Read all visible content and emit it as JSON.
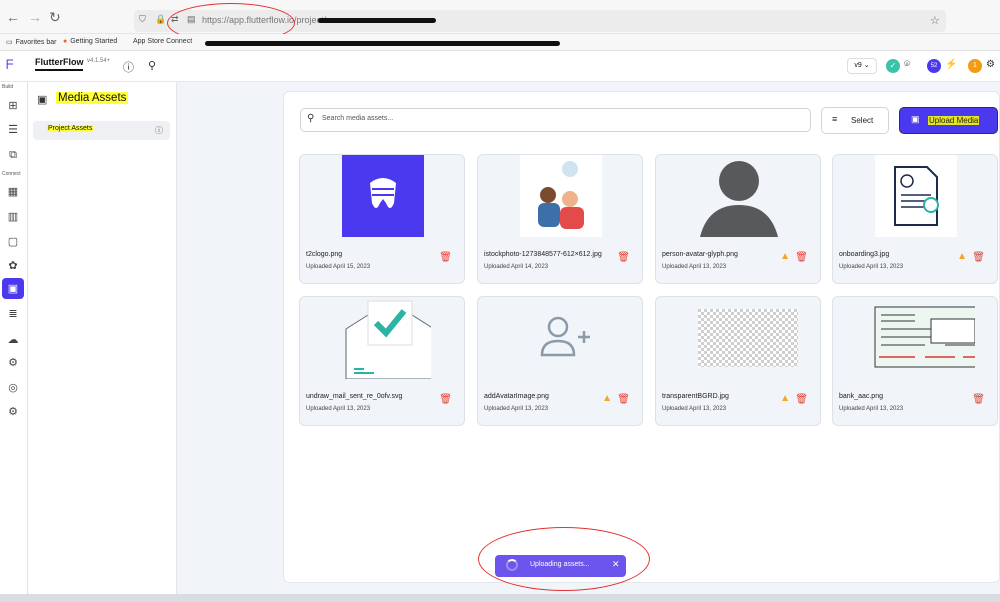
{
  "browser": {
    "url": "https://app.flutterflow.io/project/",
    "favorites": [
      "Favorites bar",
      "Getting Started",
      "App Store Connect"
    ]
  },
  "header": {
    "brand": "FlutterFlow",
    "version": "v4.1.54+",
    "version_picker": "v9",
    "badge_count": "52",
    "notification_count": "1"
  },
  "rail": {
    "build_label": "Build",
    "connect_label": "Connect"
  },
  "panel": {
    "title": "Media Assets",
    "item": "Project Assets"
  },
  "toolbar": {
    "search_placeholder": "Search media assets...",
    "select_label": "Select",
    "upload_label": "Upload Media"
  },
  "assets": [
    {
      "name": "t2clogo.png",
      "date": "Uploaded April 15, 2023",
      "warning": false
    },
    {
      "name": "istockphoto-1273848577-612×612.jpg",
      "date": "Uploaded April 14, 2023",
      "warning": false
    },
    {
      "name": "person-avatar-glyph.png",
      "date": "Uploaded April 13, 2023",
      "warning": true
    },
    {
      "name": "onboarding3.jpg",
      "date": "Uploaded April 13, 2023",
      "warning": true
    },
    {
      "name": "undraw_mail_sent_re_0ofv.svg",
      "date": "Uploaded April 13, 2023",
      "warning": false
    },
    {
      "name": "addAvatarImage.png",
      "date": "Uploaded April 13, 2023",
      "warning": true
    },
    {
      "name": "transparentBGRD.jpg",
      "date": "Uploaded April 13, 2023",
      "warning": true
    },
    {
      "name": "bank_aac.png",
      "date": "Uploaded April 13, 2023",
      "warning": false
    }
  ],
  "toast": {
    "label": "Uploading assets...",
    "close": "✕"
  },
  "colors": {
    "accent": "#4b39ef",
    "highlight": "#ffff3a",
    "annotation": "#e53131"
  }
}
